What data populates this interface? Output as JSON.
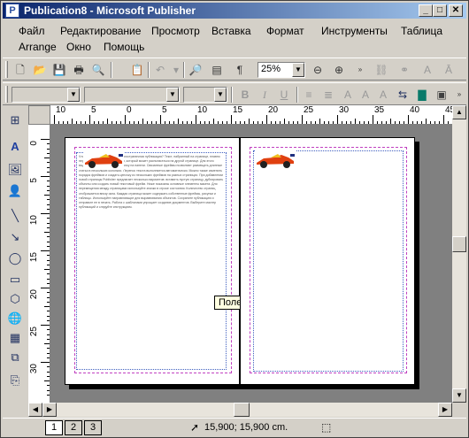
{
  "window": {
    "title": "Publication8 - Microsoft Publisher",
    "app_icon": "publisher-icon"
  },
  "menus": {
    "row1": [
      "Файл",
      "Редактирование",
      "Просмотр",
      "Вставка",
      "Формат",
      "Инструменты",
      "Таблица"
    ],
    "row2": [
      "Arrange",
      "Окно",
      "Помощь"
    ]
  },
  "standard_toolbar": {
    "zoom": "25%",
    "icons": [
      "new-icon",
      "open-icon",
      "save-icon",
      "print-icon",
      "print-preview-icon",
      "paste-icon",
      "undo-icon",
      "redo-icon",
      "find-icon",
      "formatting-marks-icon",
      "zoom-out-icon",
      "zoom-in-icon",
      "link-icon",
      "unlink-icon",
      "font-color-icon",
      "style-icon"
    ]
  },
  "formatting_toolbar": {
    "style_value": "",
    "font_value": "",
    "size_value": "",
    "bold": "B",
    "italic": "I",
    "underline": "U"
  },
  "ruler": {
    "horizontal_labels": [
      "10",
      "5",
      "0",
      "5",
      "10",
      "15",
      "20",
      "25",
      "30",
      "35",
      "40",
      "45"
    ],
    "vertical_labels": [
      "0",
      "5",
      "10",
      "15",
      "20",
      "25",
      "30"
    ]
  },
  "document": {
    "tooltip": "Поле",
    "left_page_text": "Что же представляет собой многостраничная публикация? Текст, набранный на странице, плавно переходит в следующий фрейм, который может располагаться на другой странице. Для этого выделите фрейм и нажмите кнопку на панели. Связанные фреймы позволяют размещать длинные статьи в нескольких колонках. Перенос текста выполняется автоматически. Можно также изменить порядок фреймов и создать цепочку из нескольких фреймов на разных страницах. При добавлении новой страницы Publisher предлагает несколько вариантов: вставить пустую страницу, дублировать объекты или создать новый текстовый фрейм. Ниже показаны основные элементы макета. Для перемещения между страницами используйте значки в строке состояния. Количество страниц отображается внизу окна. Каждая страница может содержать собственные фреймы, рисунки и таблицы. Используйте направляющие для выравнивания объектов. Сохраните публикацию и отправьте ее в печать. Работа с шаблонами упрощает создание документов. Выберите мастер публикаций и следуйте инструкциям.",
    "right_page_text": ""
  },
  "status_bar": {
    "pages": [
      "1",
      "2",
      "3"
    ],
    "active_page": "1",
    "coordinates": "15,900; 15,900 cm."
  },
  "colors": {
    "title_start": "#0a246a",
    "title_end": "#a6caf0",
    "workspace": "#808080",
    "margin_guide": "#c040c0",
    "frame_guide": "#4060c0"
  }
}
